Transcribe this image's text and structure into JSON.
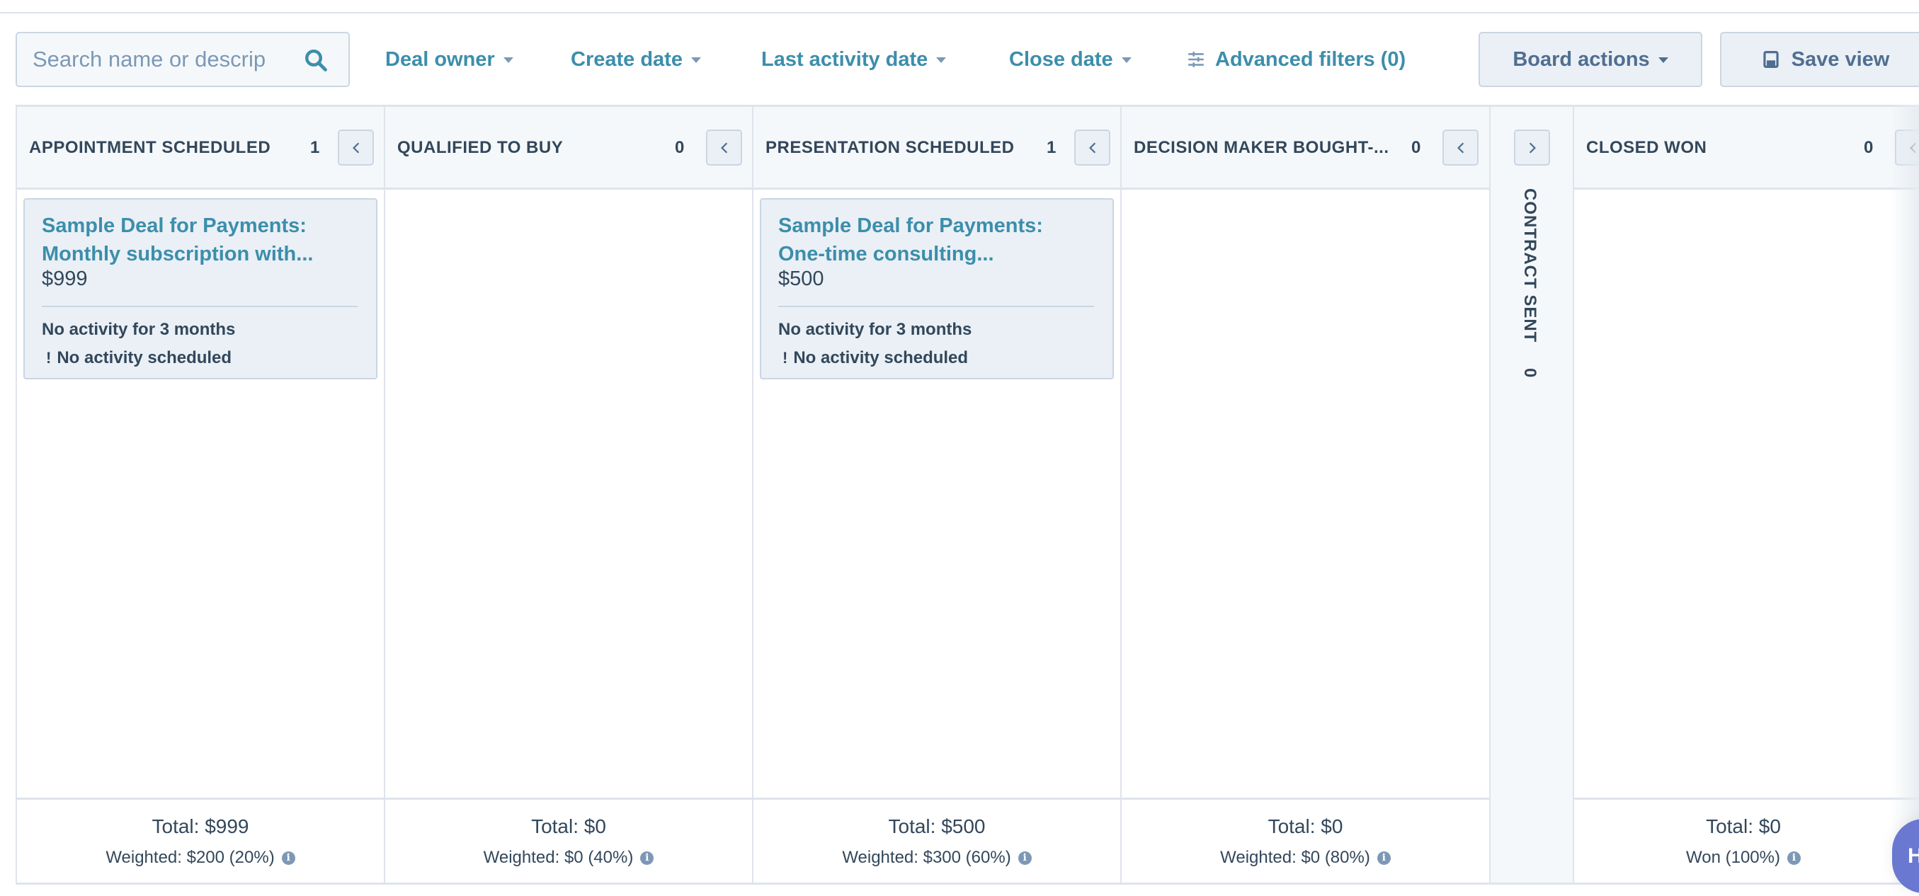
{
  "search": {
    "placeholder": "Search name or descrip",
    "value": ""
  },
  "filters": [
    {
      "label": "Deal owner"
    },
    {
      "label": "Create date"
    },
    {
      "label": "Last activity date"
    },
    {
      "label": "Close date"
    }
  ],
  "advanced_filters": {
    "label": "Advanced filters (0)"
  },
  "board_actions": {
    "label": "Board actions"
  },
  "save_view": {
    "label": "Save view"
  },
  "columns": [
    {
      "title": "APPOINTMENT SCHEDULED",
      "count": "1",
      "cards": [
        {
          "title_line1": "Sample Deal for Payments:",
          "title_line2": "Monthly subscription with...",
          "amount": "$999",
          "activity": "No activity for 3 months",
          "scheduled": "No activity scheduled"
        }
      ],
      "total": "Total: $999",
      "weighted": "Weighted: $200 (20%)"
    },
    {
      "title": "QUALIFIED TO BUY",
      "count": "0",
      "cards": [],
      "total": "Total: $0",
      "weighted": "Weighted: $0 (40%)"
    },
    {
      "title": "PRESENTATION SCHEDULED",
      "count": "1",
      "cards": [
        {
          "title_line1": "Sample Deal for Payments:",
          "title_line2": "One-time consulting...",
          "amount": "$500",
          "activity": "No activity for 3 months",
          "scheduled": "No activity scheduled"
        }
      ],
      "total": "Total: $500",
      "weighted": "Weighted: $300 (60%)"
    },
    {
      "title": "DECISION MAKER BOUGHT-...",
      "count": "0",
      "cards": [],
      "total": "Total: $0",
      "weighted": "Weighted: $0 (80%)"
    },
    {
      "title": "CONTRACT SENT",
      "count": "0",
      "collapsed": true
    },
    {
      "title": "CLOSED WON",
      "count": "0",
      "cards": [],
      "total": "Total: $0",
      "weighted": "Won (100%)"
    }
  ],
  "help_button": {
    "label": "H"
  },
  "colors": {
    "link": "#3c8eab",
    "text": "#33475b",
    "border": "#cbd6e2",
    "header_bg": "#f5f8fa",
    "card_bg": "#eaf0f6",
    "help_bg": "#6a78d1"
  }
}
